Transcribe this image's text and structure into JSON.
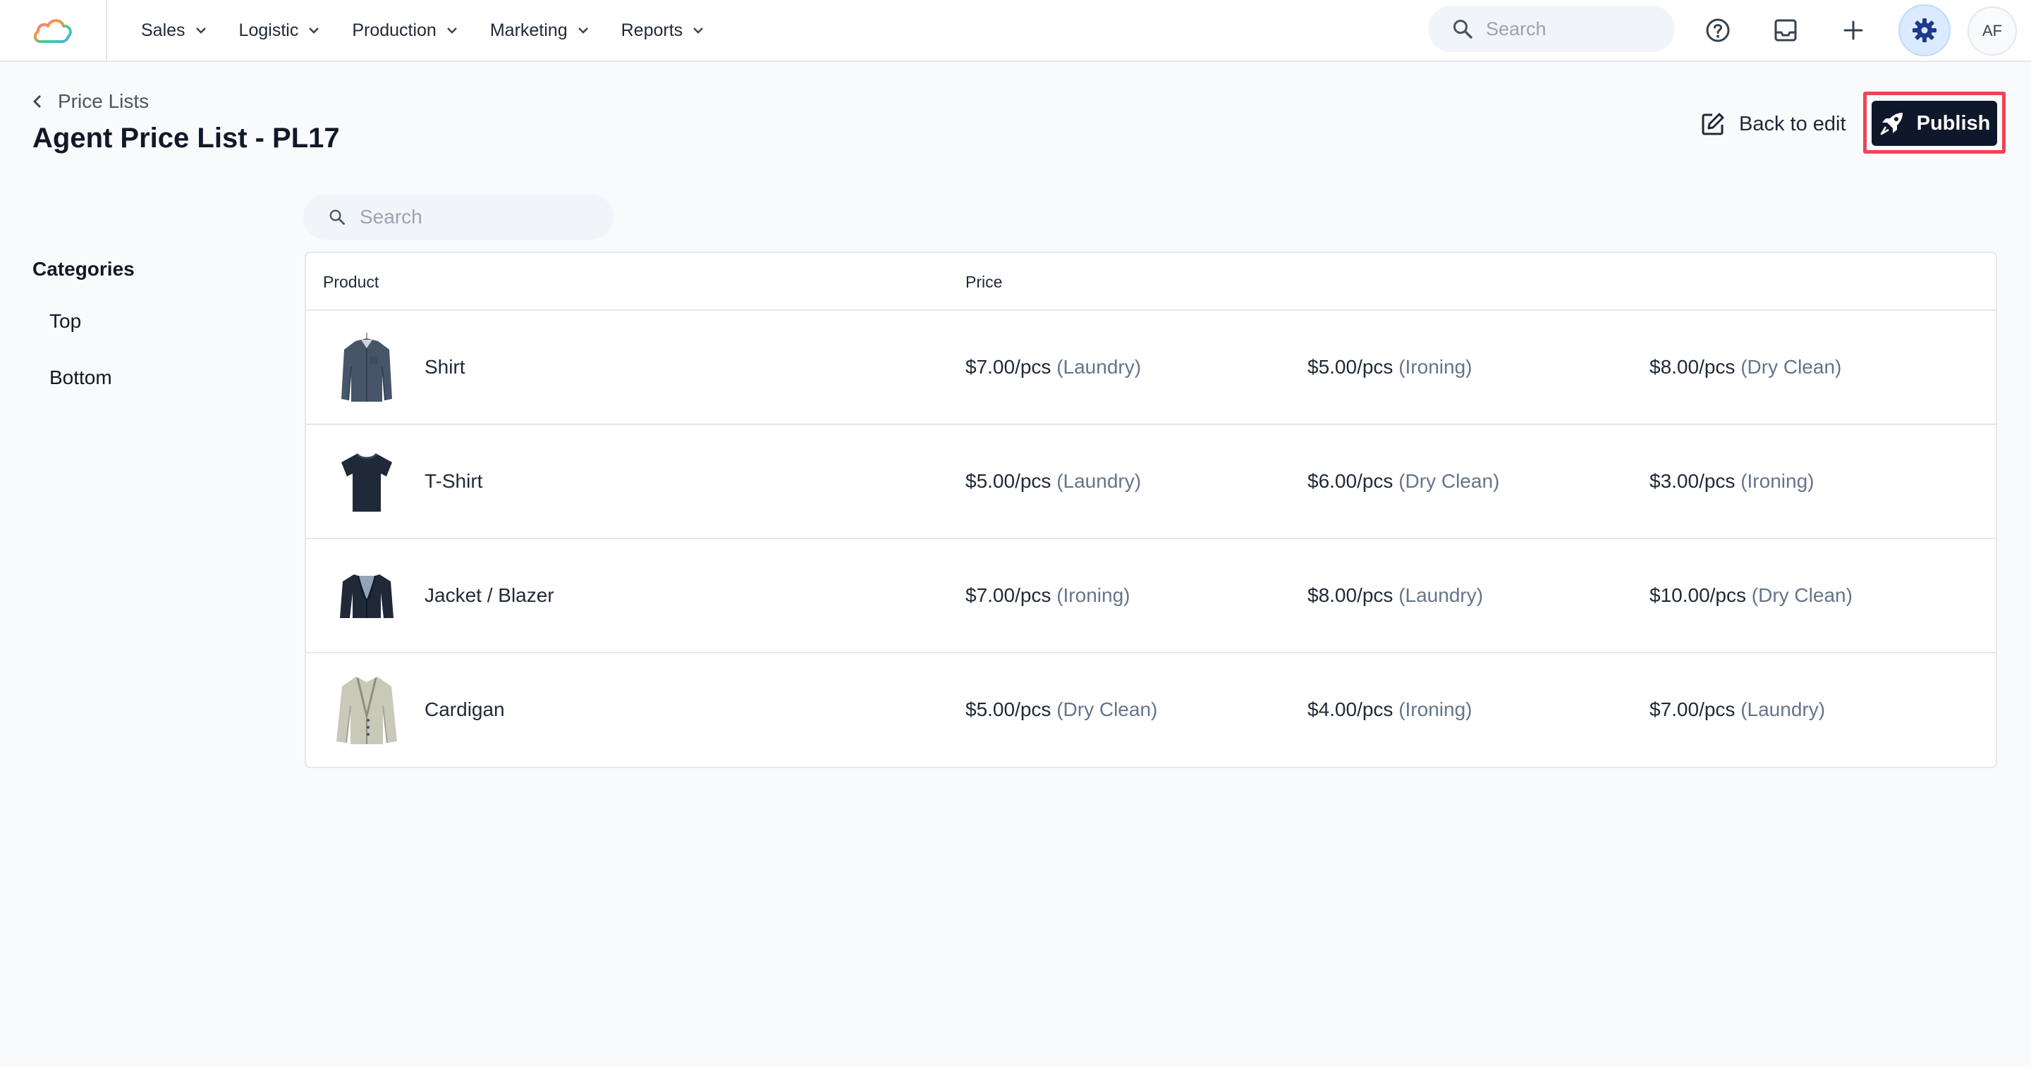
{
  "nav": {
    "items": [
      {
        "label": "Sales"
      },
      {
        "label": "Logistic"
      },
      {
        "label": "Production"
      },
      {
        "label": "Marketing"
      },
      {
        "label": "Reports"
      }
    ],
    "search_placeholder": "Search",
    "avatar_initials": "AF"
  },
  "header": {
    "breadcrumb": "Price Lists",
    "title": "Agent Price List - PL17",
    "back_to_edit": "Back to edit",
    "publish": "Publish"
  },
  "sidebar": {
    "title": "Categories",
    "items": [
      {
        "label": "Top"
      },
      {
        "label": "Bottom"
      }
    ]
  },
  "table": {
    "search_placeholder": "Search",
    "columns": {
      "product": "Product",
      "price": "Price"
    },
    "rows": [
      {
        "product": "Shirt",
        "prices": [
          {
            "amount": "$7.00/pcs",
            "service": "(Laundry)"
          },
          {
            "amount": "$5.00/pcs",
            "service": "(Ironing)"
          },
          {
            "amount": "$8.00/pcs",
            "service": "(Dry Clean)"
          }
        ]
      },
      {
        "product": "T-Shirt",
        "prices": [
          {
            "amount": "$5.00/pcs",
            "service": "(Laundry)"
          },
          {
            "amount": "$6.00/pcs",
            "service": "(Dry Clean)"
          },
          {
            "amount": "$3.00/pcs",
            "service": "(Ironing)"
          }
        ]
      },
      {
        "product": "Jacket / Blazer",
        "prices": [
          {
            "amount": "$7.00/pcs",
            "service": "(Ironing)"
          },
          {
            "amount": "$8.00/pcs",
            "service": "(Laundry)"
          },
          {
            "amount": "$10.00/pcs",
            "service": "(Dry Clean)"
          }
        ]
      },
      {
        "product": "Cardigan",
        "prices": [
          {
            "amount": "$5.00/pcs",
            "service": "(Dry Clean)"
          },
          {
            "amount": "$4.00/pcs",
            "service": "(Ironing)"
          },
          {
            "amount": "$7.00/pcs",
            "service": "(Laundry)"
          }
        ]
      }
    ]
  },
  "colors": {
    "primary_button": "#0f172a",
    "highlight_outline": "#ef4456",
    "settings_accent": "#1e3a8a"
  },
  "icons": {
    "logo": "cloud-logo-icon",
    "search": "search-icon",
    "help": "help-icon",
    "inbox": "inbox-icon",
    "add": "plus-icon",
    "settings": "gear-icon",
    "edit": "edit-icon",
    "publish": "rocket-icon"
  }
}
